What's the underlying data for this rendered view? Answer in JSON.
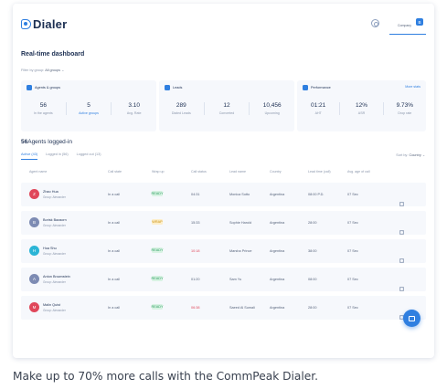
{
  "app": {
    "name": "Dialer"
  },
  "header": {
    "company_label": "Company",
    "company_badge": "B"
  },
  "dashboard": {
    "title": "Real-time dashboard",
    "filter_label": "Filter by group:",
    "filter_value": "All groups"
  },
  "cards": [
    {
      "title": "Agents & groups",
      "link": "",
      "stats": [
        {
          "value": "56",
          "label": "In the agents",
          "accent": false
        },
        {
          "value": "5",
          "label": "Active groups",
          "accent": true
        },
        {
          "value": "3.10",
          "label": "Avg. Rate",
          "accent": false
        }
      ]
    },
    {
      "title": "Leads",
      "link": "",
      "stats": [
        {
          "value": "289",
          "label": "Dialed Leads",
          "accent": false
        },
        {
          "value": "12",
          "label": "Converted",
          "accent": false
        },
        {
          "value": "10,456",
          "label": "Upcoming",
          "accent": false
        }
      ]
    },
    {
      "title": "Performance",
      "link": "More stats",
      "stats": [
        {
          "value": "01:21",
          "label": "AHT",
          "accent": false
        },
        {
          "value": "12%",
          "label": "ASR",
          "accent": false
        },
        {
          "value": "9.73%",
          "label": "Drop rate",
          "accent": false
        }
      ]
    }
  ],
  "agents": {
    "count": "56",
    "title": "Agents logged-in",
    "tabs": [
      "Active (43)",
      "Logged in (56)",
      "Logged out (13)"
    ],
    "sort_label": "Sort by:",
    "sort_value": "Country",
    "columns": [
      "Agent name",
      "Call state",
      "Wrap up",
      "Call status",
      "Lead name",
      "Country",
      "Lead time (call)",
      "Avg. age of call"
    ],
    "rows": [
      {
        "initial": "Z",
        "name": "Zhao Hua",
        "group": "Group: Alexander",
        "state": "In a call",
        "wrap": "READY",
        "wrap_type": "ready",
        "status": "04:31",
        "status_alert": false,
        "lead": "Monica Sotto",
        "country": "Argentina",
        "lead_time": "08:00 P.D.",
        "avg": "07 Sec",
        "color": "#e0475a"
      },
      {
        "initial": "B",
        "name": "Borisk Bazaorn",
        "group": "Group: Alexander",
        "state": "In a call",
        "wrap": "WRAP",
        "wrap_type": "wrap",
        "status": "15:33",
        "status_alert": false,
        "lead": "Sophie Harold",
        "country": "Argentina",
        "lead_time": "28:00",
        "avg": "07 Sec",
        "color": "#7d8bb3"
      },
      {
        "initial": "H",
        "name": "Hua Shu",
        "group": "Group: Alexander",
        "state": "In a call",
        "wrap": "READY",
        "wrap_type": "ready",
        "status": "10:18",
        "status_alert": true,
        "lead": "Marsha Prince",
        "country": "Argentina",
        "lead_time": "38:00",
        "avg": "07 Sec",
        "color": "#2bb5d6"
      },
      {
        "initial": "A",
        "name": "Anton Brownstein",
        "group": "Group: Alexander",
        "state": "In a call",
        "wrap": "READY",
        "wrap_type": "ready",
        "status": "01:20",
        "status_alert": false,
        "lead": "Sam Yu",
        "country": "Argentina",
        "lead_time": "08:00",
        "avg": "07 Sec",
        "color": "#7d8bb3"
      },
      {
        "initial": "M",
        "name": "Malin Quist",
        "group": "Group: Alexander",
        "state": "In a call",
        "wrap": "READY",
        "wrap_type": "ready",
        "status": "06:38",
        "status_alert": true,
        "lead": "Saeed Al Sumali",
        "country": "Argentina",
        "lead_time": "28:00",
        "avg": "07 Sec",
        "color": "#e0475a"
      }
    ]
  },
  "caption": "Make up to 70% more calls with the CommPeak Dialer.",
  "colors": {
    "accent": "#2f7fe0",
    "text_dark": "#1c2f52",
    "alert": "#e0475a"
  }
}
